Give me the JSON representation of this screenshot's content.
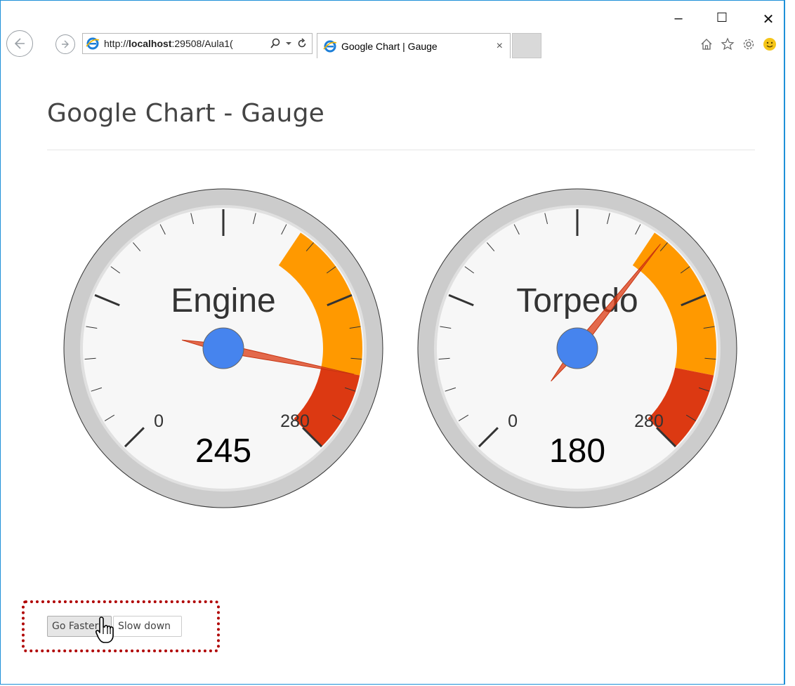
{
  "browser": {
    "address_prefix": "http://",
    "address_host": "localhost",
    "address_rest": ":29508/Aula1(",
    "tab_title": "Google Chart | Gauge",
    "tab_close": "×",
    "minimize": "–",
    "maximize": "☐",
    "close": "✕"
  },
  "page": {
    "title": "Google Chart - Gauge"
  },
  "buttons": {
    "faster": "Go Faster",
    "slower": "Slow down"
  },
  "colors": {
    "accent_border": "#1e90d8",
    "needle": "#dc3912",
    "hub": "#4684ee",
    "yellow_band": "#ff9900",
    "red_band": "#dc3912",
    "highlight_box": "#b00000"
  },
  "chart_data": [
    {
      "type": "gauge",
      "label": "Engine",
      "value": 245,
      "min": 0,
      "max": 280,
      "min_label": "0",
      "max_label": "280",
      "major_ticks": 5,
      "minor_ticks": 5,
      "yellow_band": [
        175,
        245
      ],
      "red_band": [
        245,
        280
      ]
    },
    {
      "type": "gauge",
      "label": "Torpedo",
      "value": 180,
      "min": 0,
      "max": 280,
      "min_label": "0",
      "max_label": "280",
      "major_ticks": 5,
      "minor_ticks": 5,
      "yellow_band": [
        175,
        245
      ],
      "red_band": [
        245,
        280
      ]
    }
  ]
}
